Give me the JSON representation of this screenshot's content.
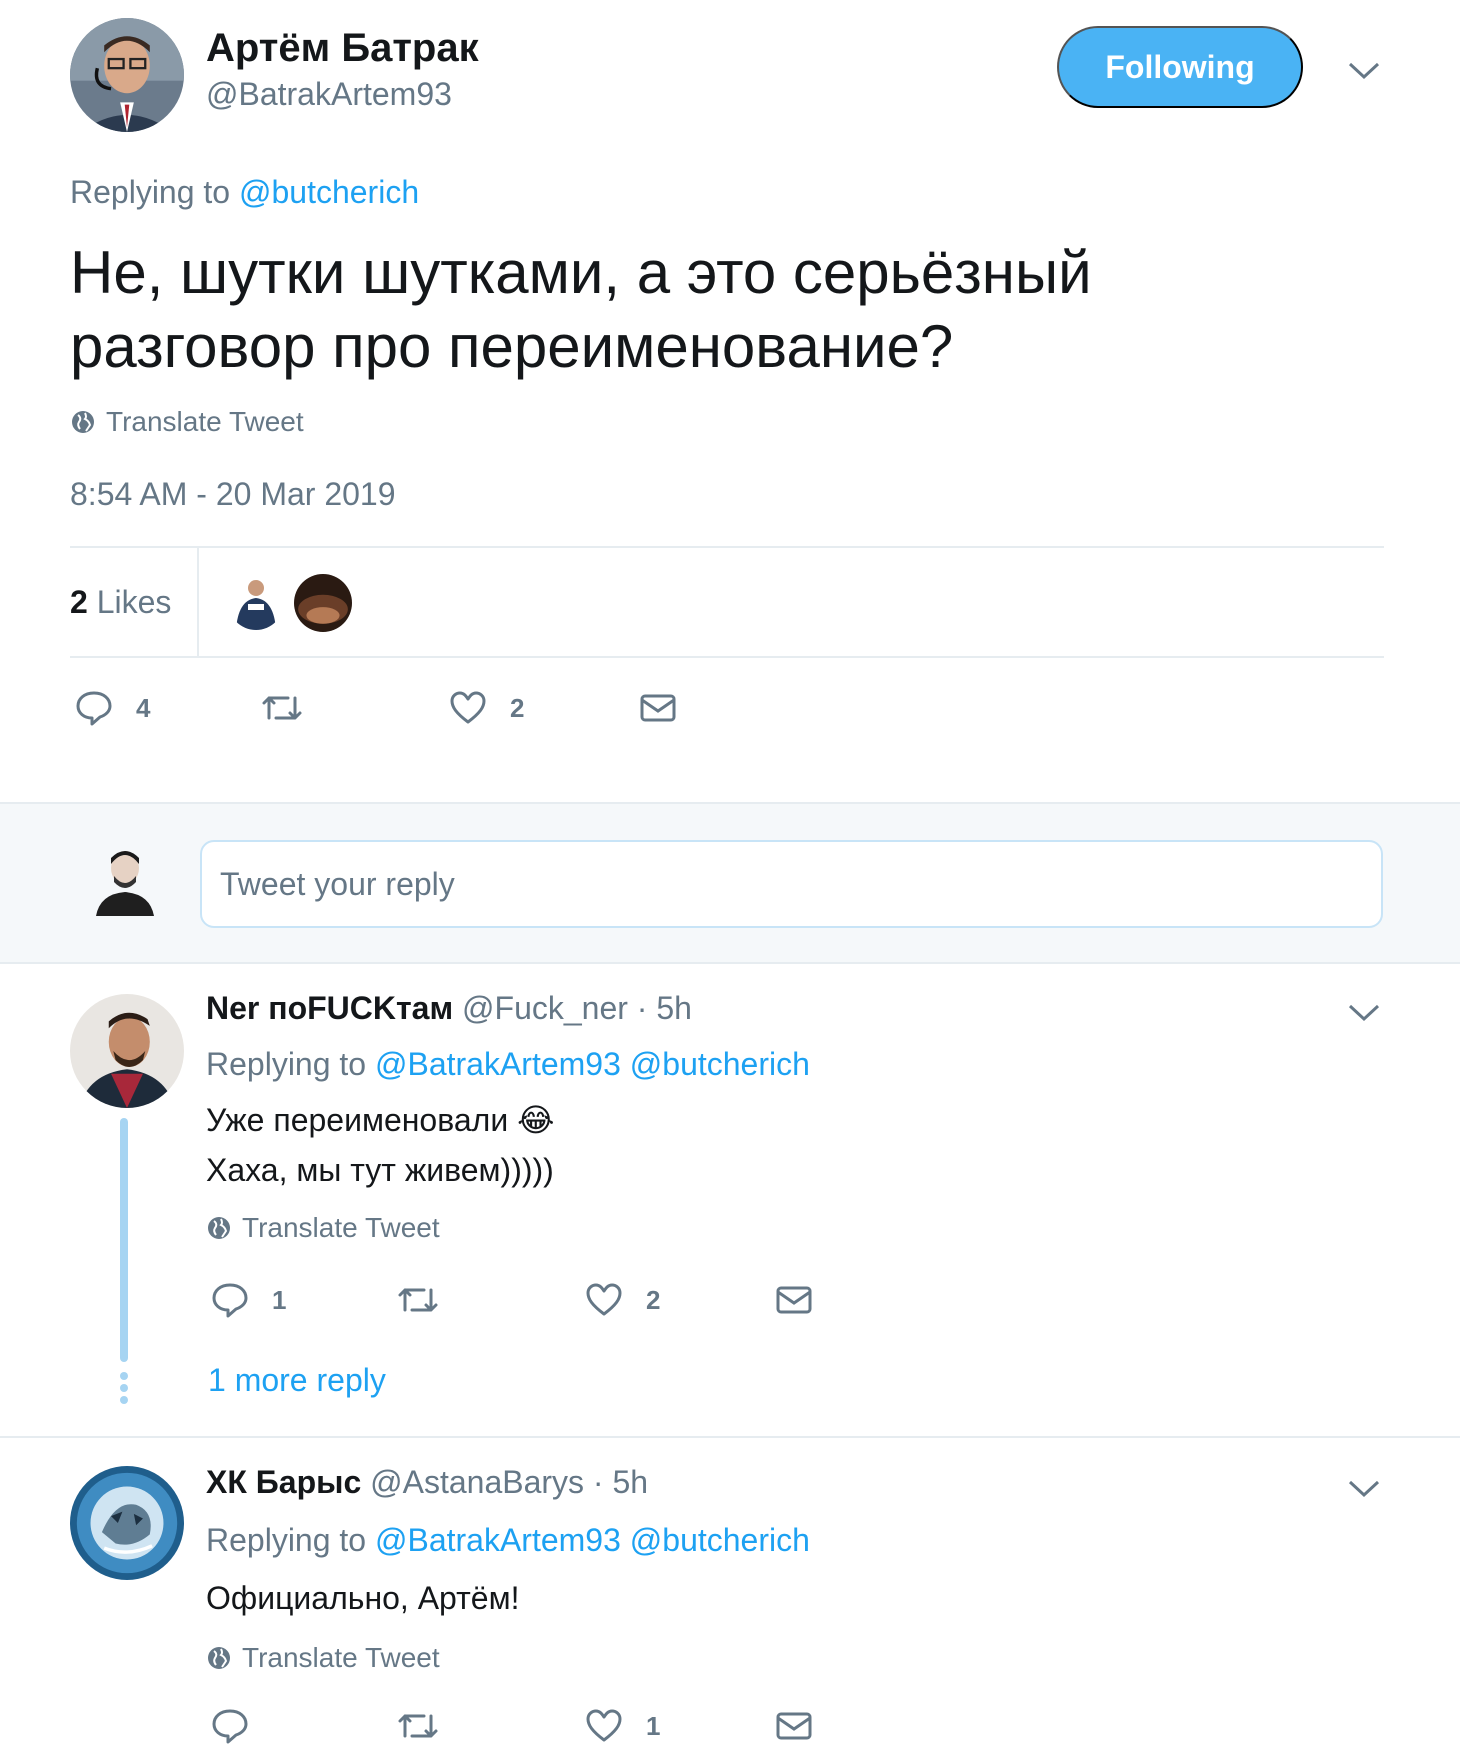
{
  "main_tweet": {
    "author_name": "Артём Батрак",
    "author_handle": "@BatrakArtem93",
    "follow_label": "Following",
    "replying_prefix": "Replying to",
    "replying_mention": "@butcherich",
    "text": "Не, шутки шутками, а это серьёзный разговор про переименование?",
    "translate_label": "Translate Tweet",
    "timestamp": "8:54 AM - 20 Mar 2019",
    "likes_number": "2",
    "likes_label": "Likes",
    "reply_count": "4",
    "retweet_count": "",
    "like_count": "2"
  },
  "composer": {
    "placeholder": "Tweet your reply"
  },
  "replies": [
    {
      "name": "Ner поFUCKтам",
      "handle": "@Fuck_ner",
      "time": "· 5h",
      "replying_prefix": "Replying to",
      "mentions": "@BatrakArtem93 @butcherich",
      "line1": "Уже переименовали 😂",
      "line2": "Хаха, мы тут живем)))))",
      "translate_label": "Translate Tweet",
      "reply_count": "1",
      "like_count": "2",
      "more_replies": "1 more reply"
    },
    {
      "name": "ХК Барыс",
      "handle": "@AstanaBarys",
      "time": "· 5h",
      "replying_prefix": "Replying to",
      "mentions": "@BatrakArtem93 @butcherich",
      "line1": "Официально, Артём!",
      "translate_label": "Translate Tweet",
      "reply_count": "",
      "like_count": "1"
    }
  ],
  "icons": {
    "reply": "speech-bubble-icon",
    "retweet": "retweet-icon",
    "like": "heart-icon",
    "dm": "envelope-icon",
    "translate": "globe-icon",
    "caret": "chevron-down-icon"
  },
  "colors": {
    "accent": "#1da1f2",
    "follow_button": "#4ab3f4",
    "secondary_text": "#657786",
    "thread_line": "#a6d4f2",
    "composer_bg": "#f5f8fa"
  }
}
